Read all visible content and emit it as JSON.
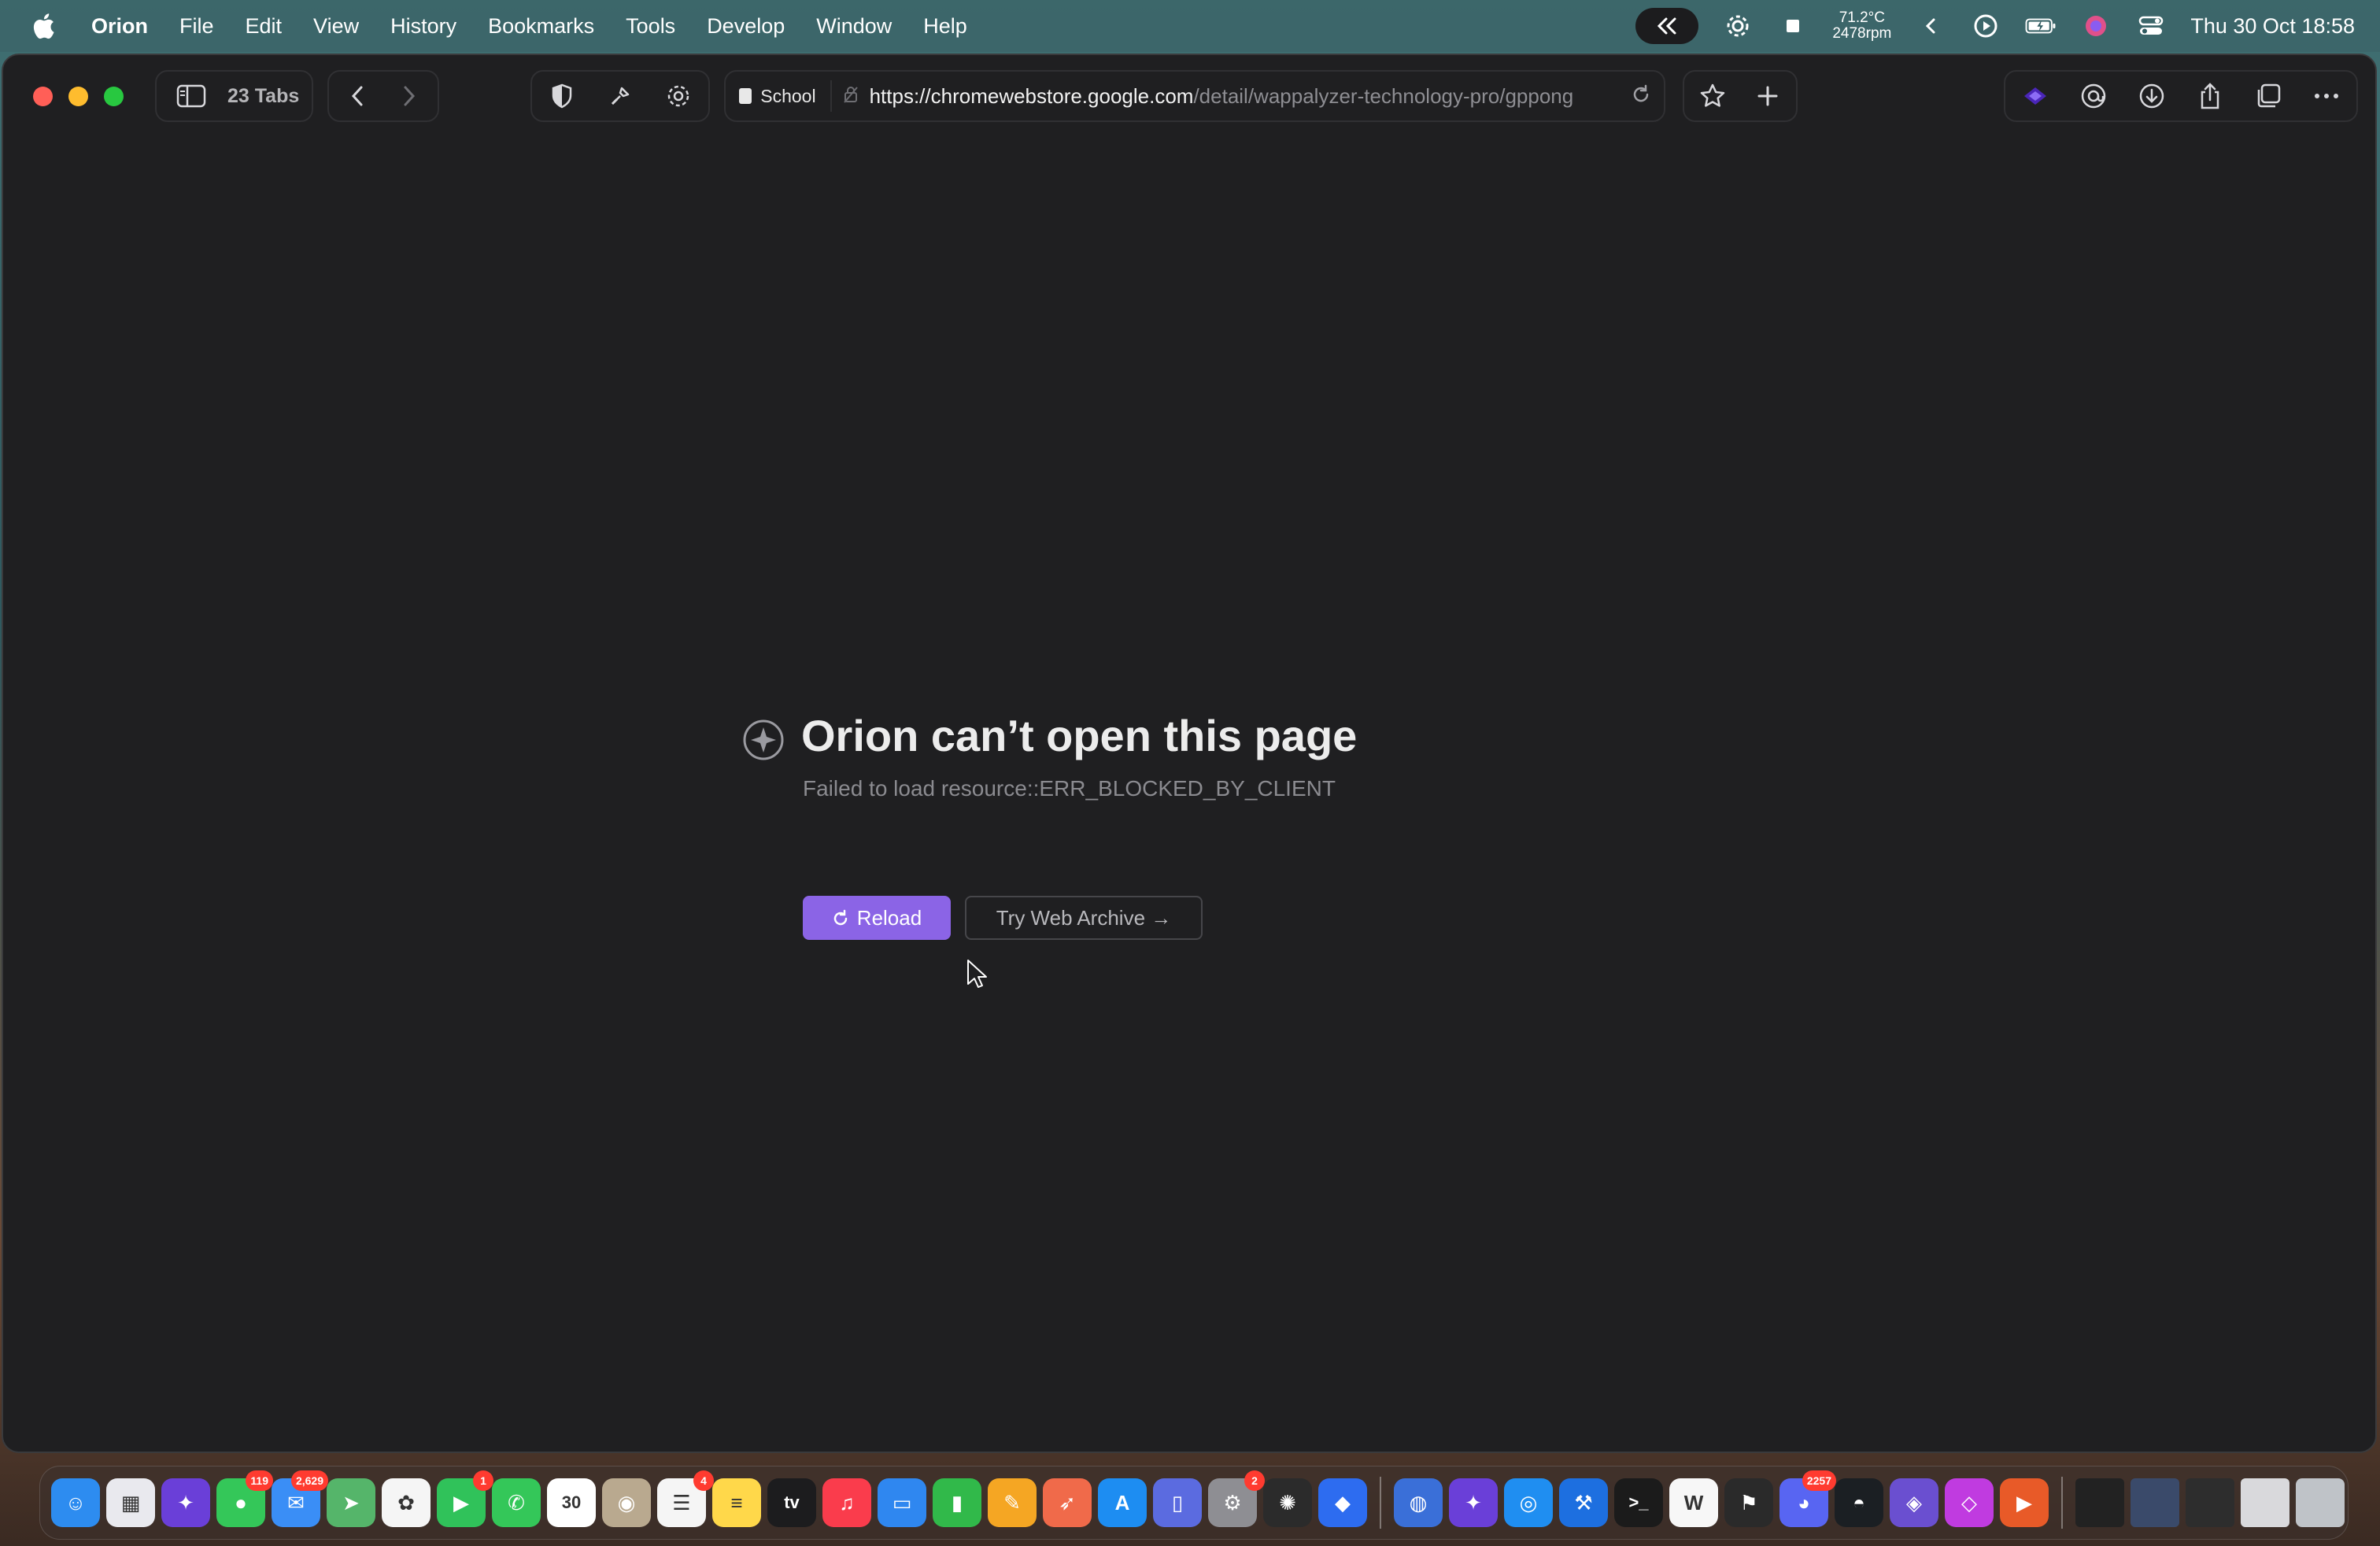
{
  "menubar": {
    "app_name": "Orion",
    "items": [
      "File",
      "Edit",
      "View",
      "History",
      "Bookmarks",
      "Tools",
      "Develop",
      "Window",
      "Help"
    ],
    "temp_line1": "71.2°C",
    "temp_line2": "2478rpm",
    "clock": "Thu 30 Oct  18:58"
  },
  "toolbar": {
    "tab_count": "23 Tabs",
    "profile": "School",
    "url_host": "https://chromewebstore.google.com",
    "url_path": "/detail/wappalyzer-technology-pro/gppong"
  },
  "error_page": {
    "title": "Orion can’t open this page",
    "subtitle": "Failed to load resource::ERR_BLOCKED_BY_CLIENT",
    "reload_label": "Reload",
    "archive_label": "Try Web Archive →"
  },
  "dock": {
    "apps": [
      {
        "name": "finder",
        "color": "#2d8cf0",
        "glyph": "☺",
        "badge": ""
      },
      {
        "name": "launchpad",
        "color": "#e9e9ee",
        "glyph": "▦",
        "badge": ""
      },
      {
        "name": "orion",
        "color": "#6a3fd8",
        "glyph": "✦",
        "badge": ""
      },
      {
        "name": "messages",
        "color": "#34c759",
        "glyph": "●",
        "badge": "119"
      },
      {
        "name": "mail",
        "color": "#3a8ef6",
        "glyph": "✉",
        "badge": "2,629"
      },
      {
        "name": "maps",
        "color": "#55b56a",
        "glyph": "➤",
        "badge": ""
      },
      {
        "name": "photos",
        "color": "#f5f5f5",
        "glyph": "✿",
        "badge": ""
      },
      {
        "name": "facetime",
        "color": "#30c25a",
        "glyph": "▶",
        "badge": "1"
      },
      {
        "name": "phone",
        "color": "#34c759",
        "glyph": "✆",
        "badge": ""
      },
      {
        "name": "calendar",
        "color": "#ffffff",
        "glyph": "30",
        "badge": ""
      },
      {
        "name": "contacts",
        "color": "#b9a98f",
        "glyph": "◉",
        "badge": ""
      },
      {
        "name": "reminders",
        "color": "#f5f5f5",
        "glyph": "☰",
        "badge": "4"
      },
      {
        "name": "notes",
        "color": "#ffd84a",
        "glyph": "≡",
        "badge": ""
      },
      {
        "name": "tv",
        "color": "#1c1c1e",
        "glyph": "tv",
        "badge": ""
      },
      {
        "name": "music",
        "color": "#fa3c4c",
        "glyph": "♫",
        "badge": ""
      },
      {
        "name": "keynote",
        "color": "#2f87f0",
        "glyph": "▭",
        "badge": ""
      },
      {
        "name": "numbers",
        "color": "#31b94a",
        "glyph": "▮",
        "badge": ""
      },
      {
        "name": "pages",
        "color": "#f5a623",
        "glyph": "✎",
        "badge": ""
      },
      {
        "name": "rocket",
        "color": "#f06a4a",
        "glyph": "➶",
        "badge": ""
      },
      {
        "name": "app-store",
        "color": "#1d8df2",
        "glyph": "A",
        "badge": ""
      },
      {
        "name": "simulator",
        "color": "#5b6be0",
        "glyph": "▯",
        "badge": ""
      },
      {
        "name": "settings",
        "color": "#8e8e93",
        "glyph": "⚙",
        "badge": "2"
      },
      {
        "name": "chatgpt",
        "color": "#2b2b2b",
        "glyph": "✺",
        "badge": ""
      },
      {
        "name": "roblox",
        "color": "#2d6cf0",
        "glyph": "◆",
        "badge": ""
      },
      {
        "name": "helper",
        "color": "#3a6fd8",
        "glyph": "◍",
        "badge": ""
      },
      {
        "name": "orion-2",
        "color": "#6a3fd8",
        "glyph": "✦",
        "badge": ""
      },
      {
        "name": "safari",
        "color": "#1f8ef1",
        "glyph": "◎",
        "badge": ""
      },
      {
        "name": "xcode",
        "color": "#1d6fe0",
        "glyph": "⚒",
        "badge": ""
      },
      {
        "name": "terminal",
        "color": "#1b1b1b",
        "glyph": ">_",
        "badge": ""
      },
      {
        "name": "wikipedia",
        "color": "#f7f7f7",
        "glyph": "W",
        "badge": ""
      },
      {
        "name": "hammer",
        "color": "#2a2a2a",
        "glyph": "⚑",
        "badge": ""
      },
      {
        "name": "discord",
        "color": "#5865f2",
        "glyph": "◕",
        "badge": "2257"
      },
      {
        "name": "github",
        "color": "#1b1f23",
        "glyph": "◓",
        "badge": ""
      },
      {
        "name": "apple-configurator",
        "color": "#6a4fd0",
        "glyph": "◈",
        "badge": ""
      },
      {
        "name": "shortcuts",
        "color": "#c03be0",
        "glyph": "◇",
        "badge": ""
      },
      {
        "name": "infuse",
        "color": "#e85a28",
        "glyph": "▶",
        "badge": ""
      }
    ],
    "trailing": [
      {
        "name": "recent-window-1",
        "color": "#222222"
      },
      {
        "name": "recent-window-2",
        "color": "#3a4a6a"
      },
      {
        "name": "recent-window-3",
        "color": "#2d2d2d"
      },
      {
        "name": "downloads-stack",
        "color": "#d9d9dc"
      },
      {
        "name": "trash",
        "color": "#bfc3c8"
      }
    ]
  }
}
